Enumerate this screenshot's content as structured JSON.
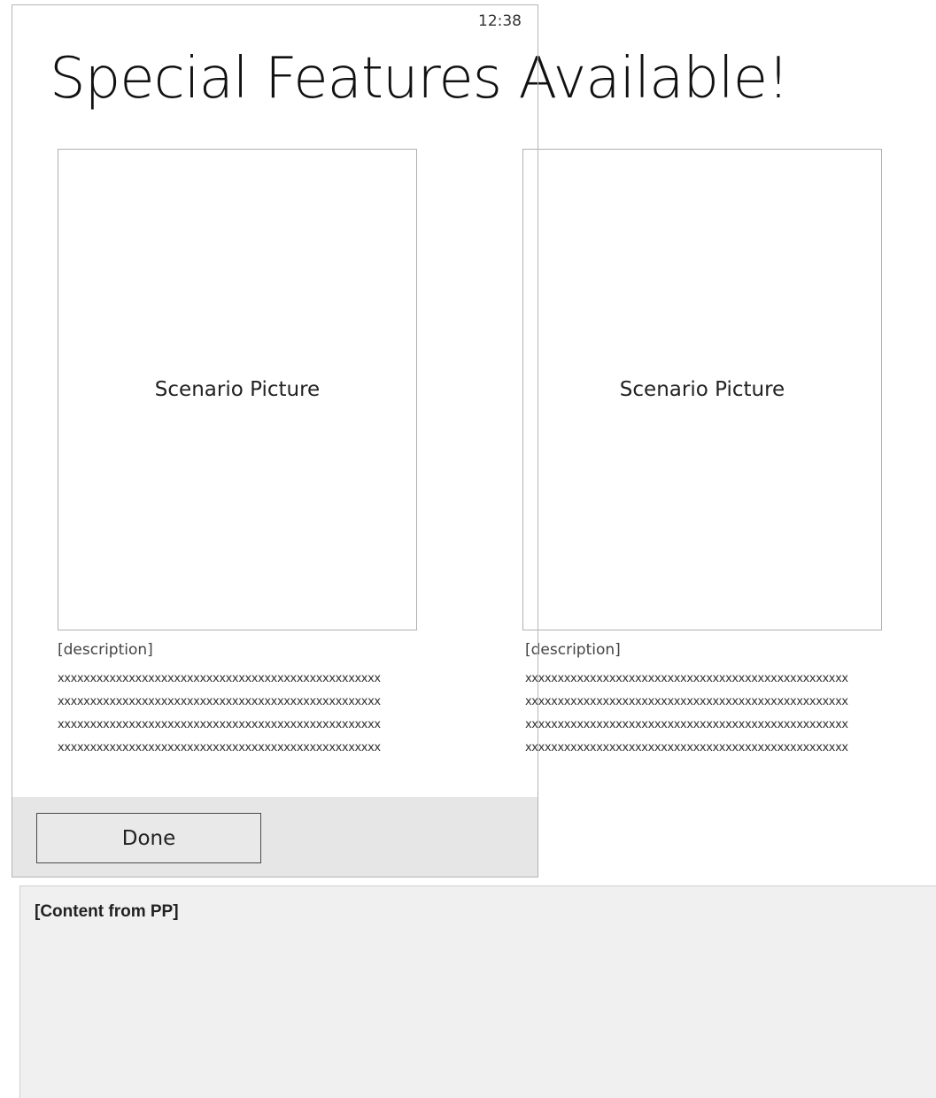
{
  "status_bar": {
    "time": "12:38"
  },
  "page": {
    "title": "Special Features Available!"
  },
  "cards": [
    {
      "picture_label": "Scenario Picture",
      "description_label": "[description]",
      "description_lines": [
        "xxxxxxxxxxxxxxxxxxxxxxxxxxxxxxxxxxxxxxxxxxxxxxxxxx",
        "xxxxxxxxxxxxxxxxxxxxxxxxxxxxxxxxxxxxxxxxxxxxxxxxxx",
        "xxxxxxxxxxxxxxxxxxxxxxxxxxxxxxxxxxxxxxxxxxxxxxxxxx",
        "xxxxxxxxxxxxxxxxxxxxxxxxxxxxxxxxxxxxxxxxxxxxxxxxxx"
      ]
    },
    {
      "picture_label": "Scenario Picture",
      "description_label": "[description]",
      "description_lines": [
        "xxxxxxxxxxxxxxxxxxxxxxxxxxxxxxxxxxxxxxxxxxxxxxxxxx",
        "xxxxxxxxxxxxxxxxxxxxxxxxxxxxxxxxxxxxxxxxxxxxxxxxxx",
        "xxxxxxxxxxxxxxxxxxxxxxxxxxxxxxxxxxxxxxxxxxxxxxxxxx",
        "xxxxxxxxxxxxxxxxxxxxxxxxxxxxxxxxxxxxxxxxxxxxxxxxxx"
      ]
    }
  ],
  "app_bar": {
    "done_label": "Done"
  },
  "notes": {
    "title": "[Content from PP]"
  }
}
